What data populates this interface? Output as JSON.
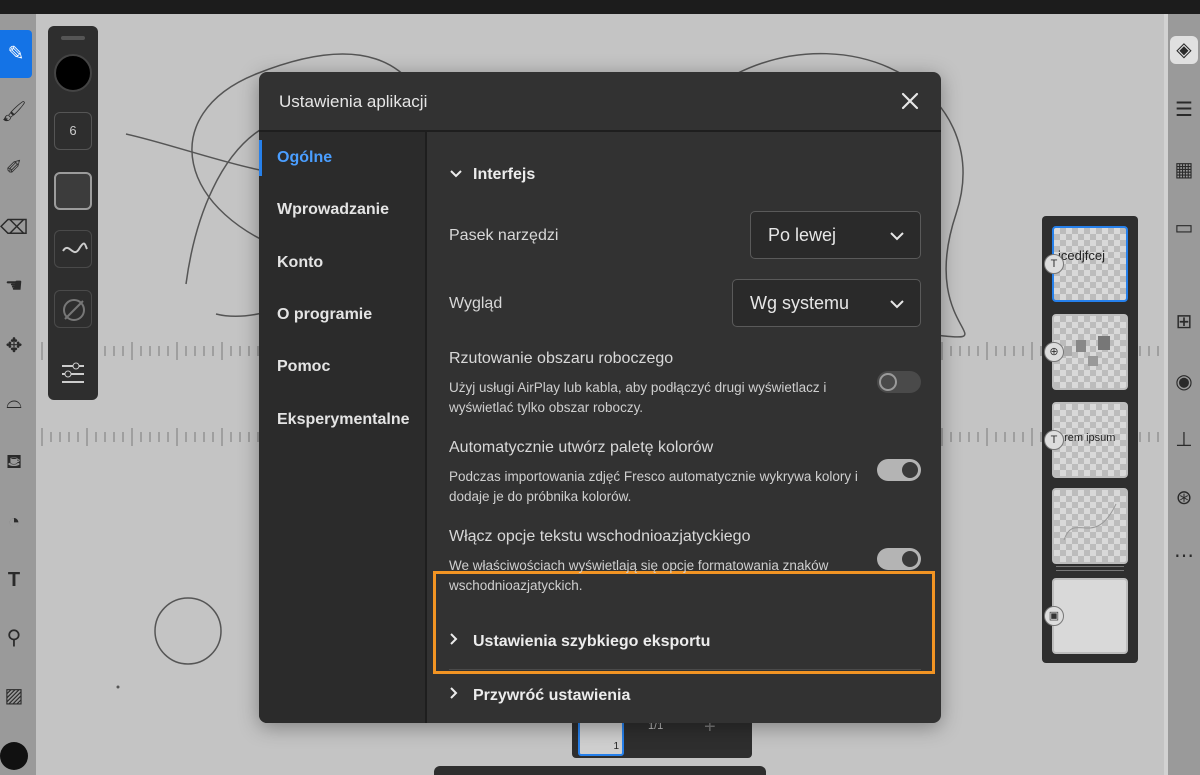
{
  "modal": {
    "title": "Ustawienia aplikacji",
    "nav": [
      {
        "label": "Ogólne",
        "active": true
      },
      {
        "label": "Wprowadzanie",
        "active": false
      },
      {
        "label": "Konto",
        "active": false
      },
      {
        "label": "O programie",
        "active": false
      },
      {
        "label": "Pomoc",
        "active": false
      },
      {
        "label": "Eksperymentalne",
        "active": false
      }
    ],
    "interface": {
      "heading": "Interfejs",
      "toolbar": {
        "label": "Pasek narzędzi",
        "value": "Po lewej"
      },
      "appearance": {
        "label": "Wygląd",
        "value": "Wg systemu"
      },
      "projection": {
        "label": "Rzutowanie obszaru roboczego",
        "description": "Użyj usługi AirPlay lub kabla, aby podłączyć drugi wyświetlacz i wyświetlać tylko obszar roboczy.",
        "enabled": false
      },
      "palette": {
        "label": "Automatycznie utwórz paletę kolorów",
        "description": "Podczas importowania zdjęć Fresco automatycznie wykrywa kolory i dodaje je do próbnika kolorów.",
        "enabled": true
      },
      "east_asian": {
        "label": "Włącz opcje tekstu wschodnioazjatyckiego",
        "description": "We właściwościach wyświetlają się opcje formatowania znaków wschodnioazjatyckich.",
        "enabled": true
      }
    },
    "sections": {
      "quick_export": "Ustawienia szybkiego eksportu",
      "reset": "Przywróć ustawienia"
    }
  },
  "brush_panel": {
    "size": "6"
  },
  "layers": [
    {
      "text": "jcedjfcej",
      "badge": "T"
    },
    {
      "text": "",
      "badge": "⊕"
    },
    {
      "text": "orem ipsum",
      "badge": "T"
    },
    {
      "text": "",
      "badge": ""
    },
    {
      "text": "",
      "badge": "▣"
    }
  ],
  "bottom_strip": {
    "page": "1/1",
    "thumb_num": "1"
  },
  "colors": {
    "accent": "#2680eb",
    "highlight": "#f29423",
    "modal_bg": "#323232"
  }
}
